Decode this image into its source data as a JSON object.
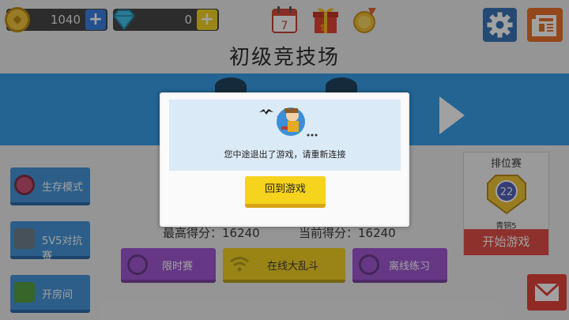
{
  "topbar": {
    "gold_value": "1040",
    "gem_value": "0",
    "plus_label": "+",
    "calendar_day": "7",
    "gift_label": "$"
  },
  "arena": {
    "title": "初级竞技场"
  },
  "modes": {
    "survival": "生存模式",
    "five_v_five": "5V5对抗赛",
    "open_room": "开房间"
  },
  "ranked": {
    "title": "排位赛",
    "badge_number": "22",
    "rank_name": "青铜5",
    "start_label": "开始游戏"
  },
  "scores": {
    "best": "最高得分：16240",
    "current": "当前得分：16240"
  },
  "bottom_buttons": {
    "timed": "限时赛",
    "online": "在线大乱斗",
    "offline": "离线练习"
  },
  "dialog": {
    "message": "您中途退出了游戏，请重新连接",
    "button": "回到游戏"
  },
  "colors": {
    "banner": "#2e9ae8",
    "accent_yellow": "#f6d31c",
    "accent_purple": "#9b4fd0",
    "start_red": "#e0453d"
  }
}
